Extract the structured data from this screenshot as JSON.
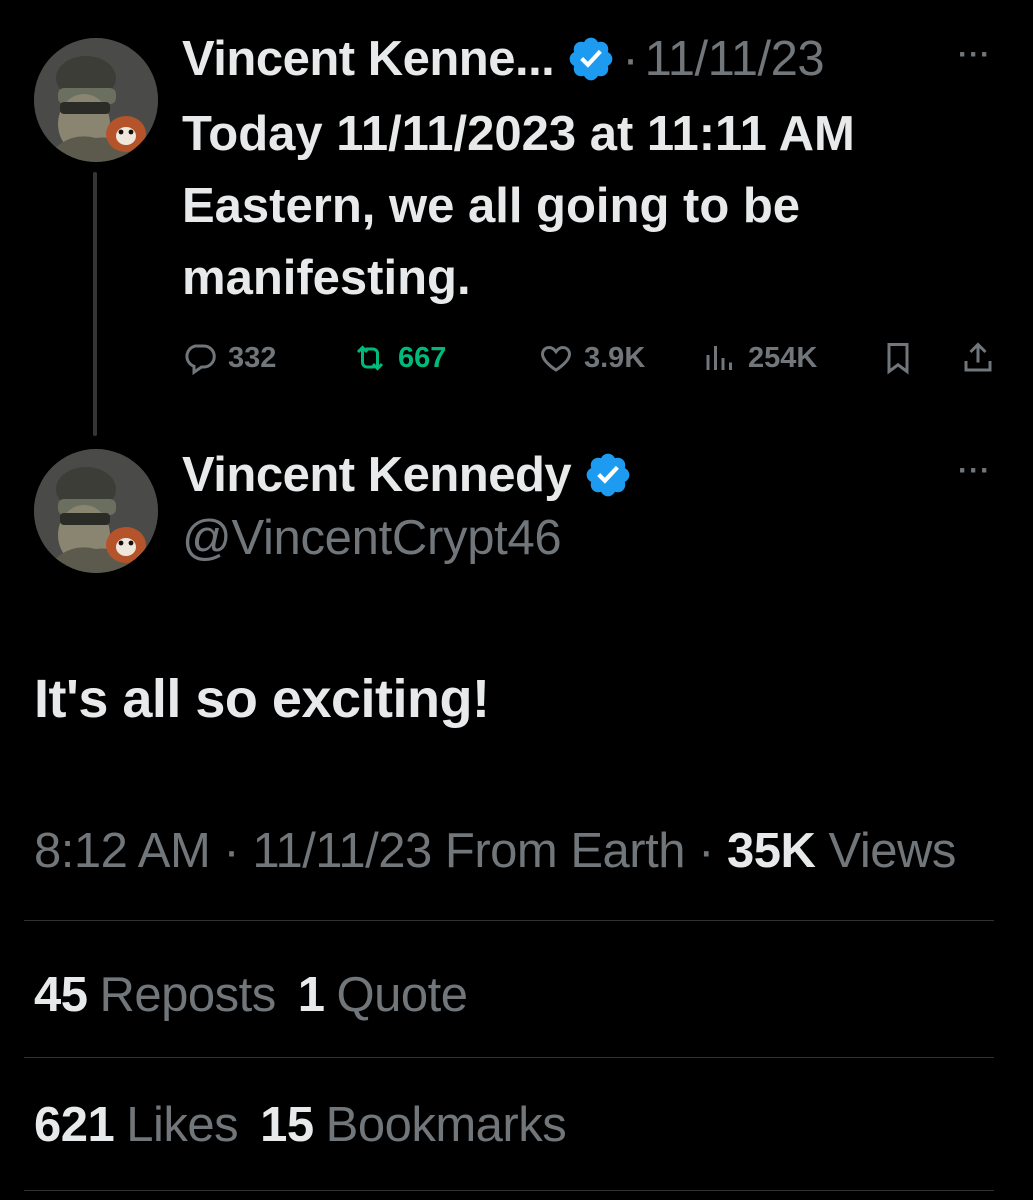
{
  "reply_tweet": {
    "author_name": "Vincent Kenne...",
    "separator": "·",
    "date": "11/11/23",
    "more": "···",
    "text": "Today 11/11/2023 at 11:11 AM Eastern, we all going to be manifesting.",
    "actions": {
      "replies": "332",
      "reposts": "667",
      "likes": "3.9K",
      "views": "254K"
    }
  },
  "main_tweet": {
    "author_name": "Vincent Kennedy",
    "handle": "@VincentCrypt46",
    "more": "···",
    "text": "It's all so exciting!",
    "meta": {
      "time": "8:12 AM",
      "sep1": " · ",
      "date": "11/11/23",
      "source": " From Earth",
      "sep2": " · ",
      "views_count": "35K",
      "views_label": " Views"
    },
    "stats": {
      "reposts_count": "45",
      "reposts_label": "Reposts",
      "quotes_count": "1",
      "quotes_label": "Quote",
      "likes_count": "621",
      "likes_label": "Likes",
      "bookmarks_count": "15",
      "bookmarks_label": "Bookmarks"
    }
  },
  "colors": {
    "background": "#000000",
    "text": "#e7e9ea",
    "muted": "#71767b",
    "verified": "#1d9bf0",
    "retweet_active": "#00ba7c",
    "divider": "#2f3336"
  },
  "icons": [
    "reply-icon",
    "retweet-icon",
    "like-icon",
    "views-icon",
    "bookmark-icon",
    "share-icon",
    "verified-icon",
    "more-icon"
  ]
}
